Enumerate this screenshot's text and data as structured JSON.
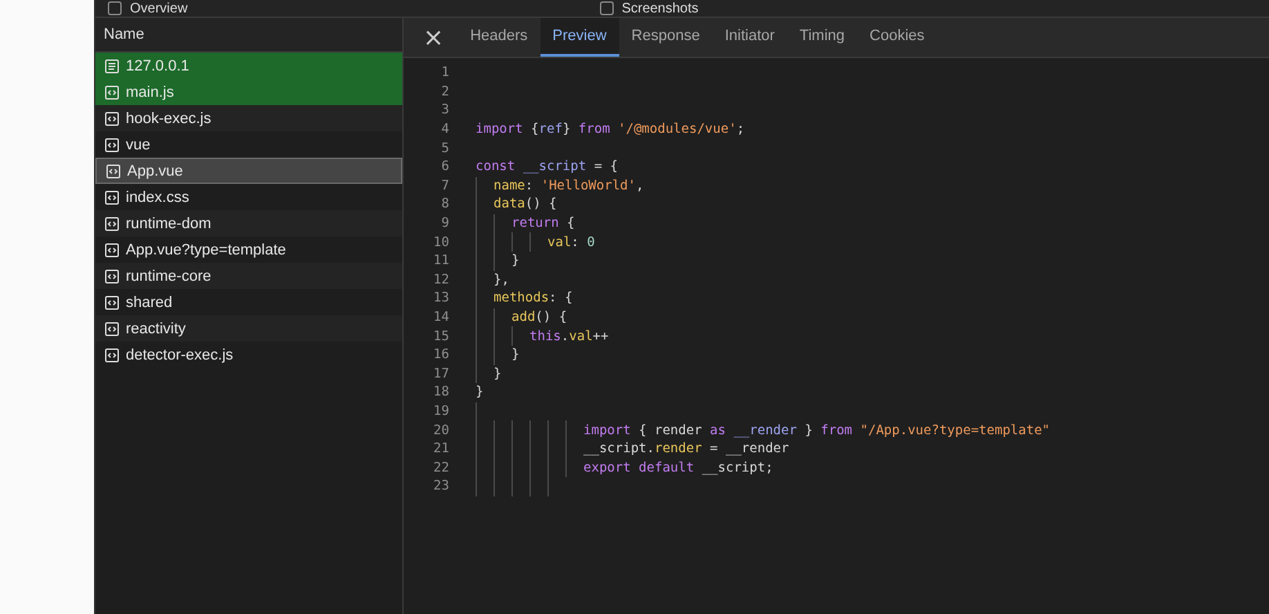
{
  "top_options": [
    {
      "label": "Overview",
      "checked": false
    },
    {
      "label": "Screenshots",
      "checked": false
    }
  ],
  "requests": {
    "header": "Name",
    "items": [
      {
        "name": "127.0.0.1",
        "kind": "document",
        "highlighted": true,
        "selected": false
      },
      {
        "name": "main.js",
        "kind": "script",
        "highlighted": true,
        "selected": false
      },
      {
        "name": "hook-exec.js",
        "kind": "script",
        "highlighted": false,
        "selected": false
      },
      {
        "name": "vue",
        "kind": "script",
        "highlighted": false,
        "selected": false
      },
      {
        "name": "App.vue",
        "kind": "script",
        "highlighted": false,
        "selected": true
      },
      {
        "name": "index.css",
        "kind": "script",
        "highlighted": false,
        "selected": false
      },
      {
        "name": "runtime-dom",
        "kind": "script",
        "highlighted": false,
        "selected": false
      },
      {
        "name": "App.vue?type=template",
        "kind": "script",
        "highlighted": false,
        "selected": false
      },
      {
        "name": "runtime-core",
        "kind": "script",
        "highlighted": false,
        "selected": false
      },
      {
        "name": "shared",
        "kind": "script",
        "highlighted": false,
        "selected": false
      },
      {
        "name": "reactivity",
        "kind": "script",
        "highlighted": false,
        "selected": false
      },
      {
        "name": "detector-exec.js",
        "kind": "script",
        "highlighted": false,
        "selected": false
      }
    ]
  },
  "close_button": "×",
  "tabs": [
    {
      "label": "Headers",
      "selected": false
    },
    {
      "label": "Preview",
      "selected": true
    },
    {
      "label": "Response",
      "selected": false
    },
    {
      "label": "Initiator",
      "selected": false
    },
    {
      "label": "Timing",
      "selected": false
    },
    {
      "label": "Cookies",
      "selected": false
    }
  ],
  "code": [
    {
      "number": "1"
    },
    {
      "number": "2"
    },
    {
      "number": "3"
    },
    {
      "number": "4",
      "tokens": [
        {
          "kind": "keyword",
          "text": "import"
        },
        {
          "kind": "plain",
          "text": " {"
        },
        {
          "kind": "variable",
          "text": "ref"
        },
        {
          "kind": "plain",
          "text": "} "
        },
        {
          "kind": "keyword",
          "text": "from"
        },
        {
          "kind": "string",
          "text": " '/@modules/vue'"
        },
        {
          "kind": "plain",
          "text": ";"
        }
      ]
    },
    {
      "number": "5"
    },
    {
      "number": "6",
      "tokens": [
        {
          "kind": "keyword",
          "text": "const"
        },
        {
          "kind": "variable",
          "text": " __script"
        },
        {
          "kind": "plain",
          "text": " = {"
        }
      ]
    },
    {
      "number": "7",
      "tokens": [
        {
          "kind": "property",
          "text": "name"
        },
        {
          "kind": "plain",
          "text": ": "
        },
        {
          "kind": "string",
          "text": "'HelloWorld'"
        },
        {
          "kind": "plain",
          "text": ","
        }
      ]
    },
    {
      "number": "8",
      "tokens": [
        {
          "kind": "property",
          "text": "data"
        },
        {
          "kind": "plain",
          "text": "() {"
        }
      ]
    },
    {
      "number": "9",
      "tokens": [
        {
          "kind": "keyword",
          "text": "return"
        },
        {
          "kind": "plain",
          "text": " {"
        }
      ]
    },
    {
      "number": "10",
      "tokens": [
        {
          "kind": "property",
          "text": "val"
        },
        {
          "kind": "plain",
          "text": ": "
        },
        {
          "kind": "number",
          "text": "0"
        }
      ]
    },
    {
      "number": "11",
      "tokens": [
        {
          "kind": "plain",
          "text": "}"
        }
      ]
    },
    {
      "number": "12",
      "tokens": [
        {
          "kind": "plain",
          "text": "},"
        }
      ]
    },
    {
      "number": "13",
      "tokens": [
        {
          "kind": "property",
          "text": "methods"
        },
        {
          "kind": "plain",
          "text": ": {"
        }
      ]
    },
    {
      "number": "14",
      "tokens": [
        {
          "kind": "property",
          "text": "add"
        },
        {
          "kind": "plain",
          "text": "() {"
        }
      ]
    },
    {
      "number": "15",
      "tokens": [
        {
          "kind": "keyword",
          "text": "this"
        },
        {
          "kind": "plain",
          "text": "."
        },
        {
          "kind": "property",
          "text": "val"
        },
        {
          "kind": "plain",
          "text": "++"
        }
      ]
    },
    {
      "number": "16",
      "tokens": [
        {
          "kind": "plain",
          "text": "}"
        }
      ]
    },
    {
      "number": "17",
      "tokens": [
        {
          "kind": "plain",
          "text": "}"
        }
      ]
    },
    {
      "number": "18",
      "tokens": [
        {
          "kind": "plain",
          "text": "}"
        }
      ]
    },
    {
      "number": "19"
    },
    {
      "number": "20",
      "tokens": [
        {
          "kind": "keyword",
          "text": "import"
        },
        {
          "kind": "plain",
          "text": " { render "
        },
        {
          "kind": "keyword",
          "text": "as"
        },
        {
          "kind": "variable",
          "text": " __render"
        },
        {
          "kind": "plain",
          "text": " } "
        },
        {
          "kind": "keyword",
          "text": "from"
        },
        {
          "kind": "string",
          "text": " \"/App.vue?type=template\""
        }
      ]
    },
    {
      "number": "21",
      "tokens": [
        {
          "kind": "plain",
          "text": "__script."
        },
        {
          "kind": "property",
          "text": "render"
        },
        {
          "kind": "plain",
          "text": " = __render"
        }
      ]
    },
    {
      "number": "22",
      "tokens": [
        {
          "kind": "keyword",
          "text": "export"
        },
        {
          "kind": "keyword",
          "text": " default"
        },
        {
          "kind": "plain",
          "text": " __script;"
        }
      ]
    },
    {
      "number": "23"
    }
  ]
}
